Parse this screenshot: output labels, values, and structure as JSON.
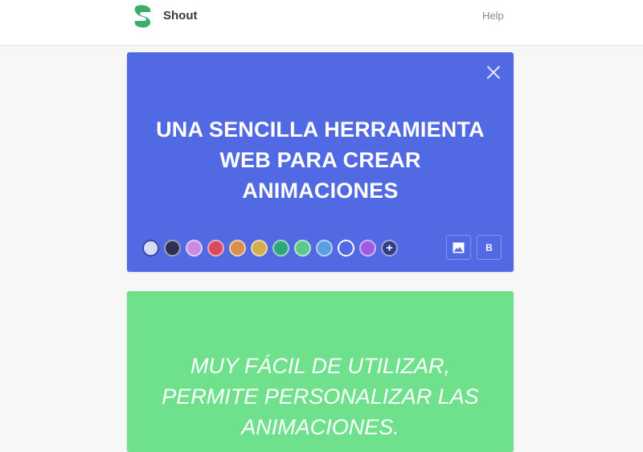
{
  "header": {
    "brand": "Shout",
    "help_label": "Help",
    "logo_color": "#3aae6a"
  },
  "cards": [
    {
      "background": "#5169e3",
      "title_lines": [
        "UNA SENCILLA HERRAMIENTA",
        "WEB PARA CREAR",
        "ANIMACIONES"
      ],
      "close_icon": "close-icon",
      "palette": [
        {
          "name": "lavender",
          "color": "#d5dcf6",
          "selected": true
        },
        {
          "name": "navy",
          "color": "#2c3052"
        },
        {
          "name": "violet",
          "color": "#c98ce6"
        },
        {
          "name": "crimson",
          "color": "#d84a5e"
        },
        {
          "name": "orange",
          "color": "#d9904f"
        },
        {
          "name": "mustard",
          "color": "#d3ae4f"
        },
        {
          "name": "teal",
          "color": "#2ea87a"
        },
        {
          "name": "mint",
          "color": "#5ec98c"
        },
        {
          "name": "sky",
          "color": "#5aa0e0"
        },
        {
          "name": "current-blue",
          "color": "#5169e3",
          "outline": true
        },
        {
          "name": "purple",
          "color": "#9c5de0"
        }
      ],
      "add_color_label": "+",
      "tools": {
        "image_icon": "image-icon",
        "bold_label": "B"
      }
    },
    {
      "background": "#6fe08c",
      "subtitle_lines": [
        "MUY FÁCIL DE UTILIZAR,",
        "PERMITE PERSONALIZAR LAS",
        "ANIMACIONES."
      ]
    }
  ]
}
